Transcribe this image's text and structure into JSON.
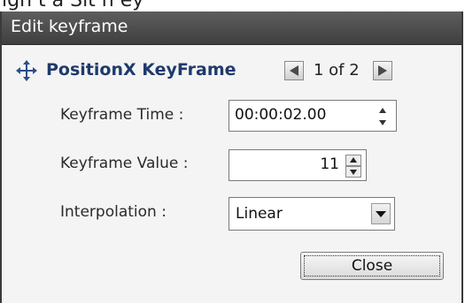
{
  "top_fragment": "ign t      a Sit  n ey",
  "dialog": {
    "title": "Edit keyframe",
    "keyframe_title": "PositionX KeyFrame",
    "counter": "1 of 2",
    "fields": {
      "time_label": "Keyframe Time :",
      "time_value": "00:00:02.00",
      "value_label": "Keyframe Value :",
      "value_value": "11",
      "interp_label": "Interpolation :",
      "interp_value": "Linear"
    },
    "close_label": "Close"
  },
  "icons": {
    "move": "move-icon",
    "prev": "arrow-left-icon",
    "next": "arrow-right-icon",
    "spin_up": "spin-up-icon",
    "spin_down": "spin-down-icon",
    "dropdown": "chevron-down-icon"
  }
}
